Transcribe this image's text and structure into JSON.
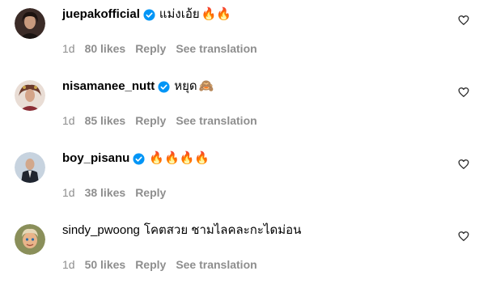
{
  "comments": [
    {
      "username": "juepakofficial",
      "verified": true,
      "text": "แม่งเอ้ย",
      "emoji": "🔥🔥",
      "time": "1d",
      "likes": "80 likes",
      "reply": "Reply",
      "translation": "See translation",
      "avatar_color": "#2a1d1a"
    },
    {
      "username": "nisamanee_nutt",
      "verified": true,
      "text": "หยุด",
      "emoji": "🙈",
      "time": "1d",
      "likes": "85 likes",
      "reply": "Reply",
      "translation": "See translation",
      "avatar_color": "#7a4a3a"
    },
    {
      "username": "boy_pisanu",
      "verified": true,
      "text": "",
      "emoji": "🔥🔥🔥🔥",
      "time": "1d",
      "likes": "38 likes",
      "reply": "Reply",
      "translation": "",
      "avatar_color": "#b9c7d4"
    },
    {
      "username": "sindy_pwoong",
      "verified": false,
      "text": "โคตสวย ชามไลคละกะไดม่อน",
      "emoji": "",
      "time": "1d",
      "likes": "50 likes",
      "reply": "Reply",
      "translation": "See translation",
      "avatar_color": "#d9a45a"
    }
  ],
  "colors": {
    "verified_blue": "#0095f6",
    "meta_gray": "#8e8e8e"
  },
  "icons": {
    "verified": "verified-badge-icon",
    "like": "heart-outline-icon"
  }
}
